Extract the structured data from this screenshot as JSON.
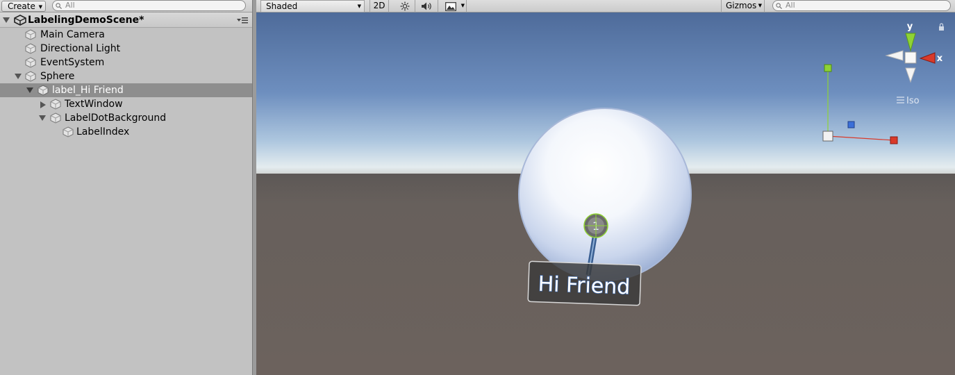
{
  "hierarchy": {
    "create_label": "Create",
    "search_placeholder": "All",
    "scene_title": "LabelingDemoScene*",
    "items": [
      {
        "label": "Main Camera"
      },
      {
        "label": "Directional Light"
      },
      {
        "label": "EventSystem"
      },
      {
        "label": "Sphere"
      },
      {
        "label": "label_Hi Friend"
      },
      {
        "label": "TextWindow"
      },
      {
        "label": "LabelDotBackground"
      },
      {
        "label": "LabelIndex"
      }
    ]
  },
  "scene_view": {
    "shading_mode": "Shaded",
    "mode_2d": "2D",
    "gizmos_label": "Gizmos",
    "search_placeholder": "All",
    "gizmo_axis_y": "y",
    "gizmo_axis_x": "x",
    "projection_label": "Iso",
    "label_index": "1",
    "label_text": "Hi Friend"
  },
  "colors": {
    "axis_x": "#d93a2a",
    "axis_y": "#8fd334",
    "axis_z": "#3b6fd8",
    "selection": "#8e8e8e"
  }
}
